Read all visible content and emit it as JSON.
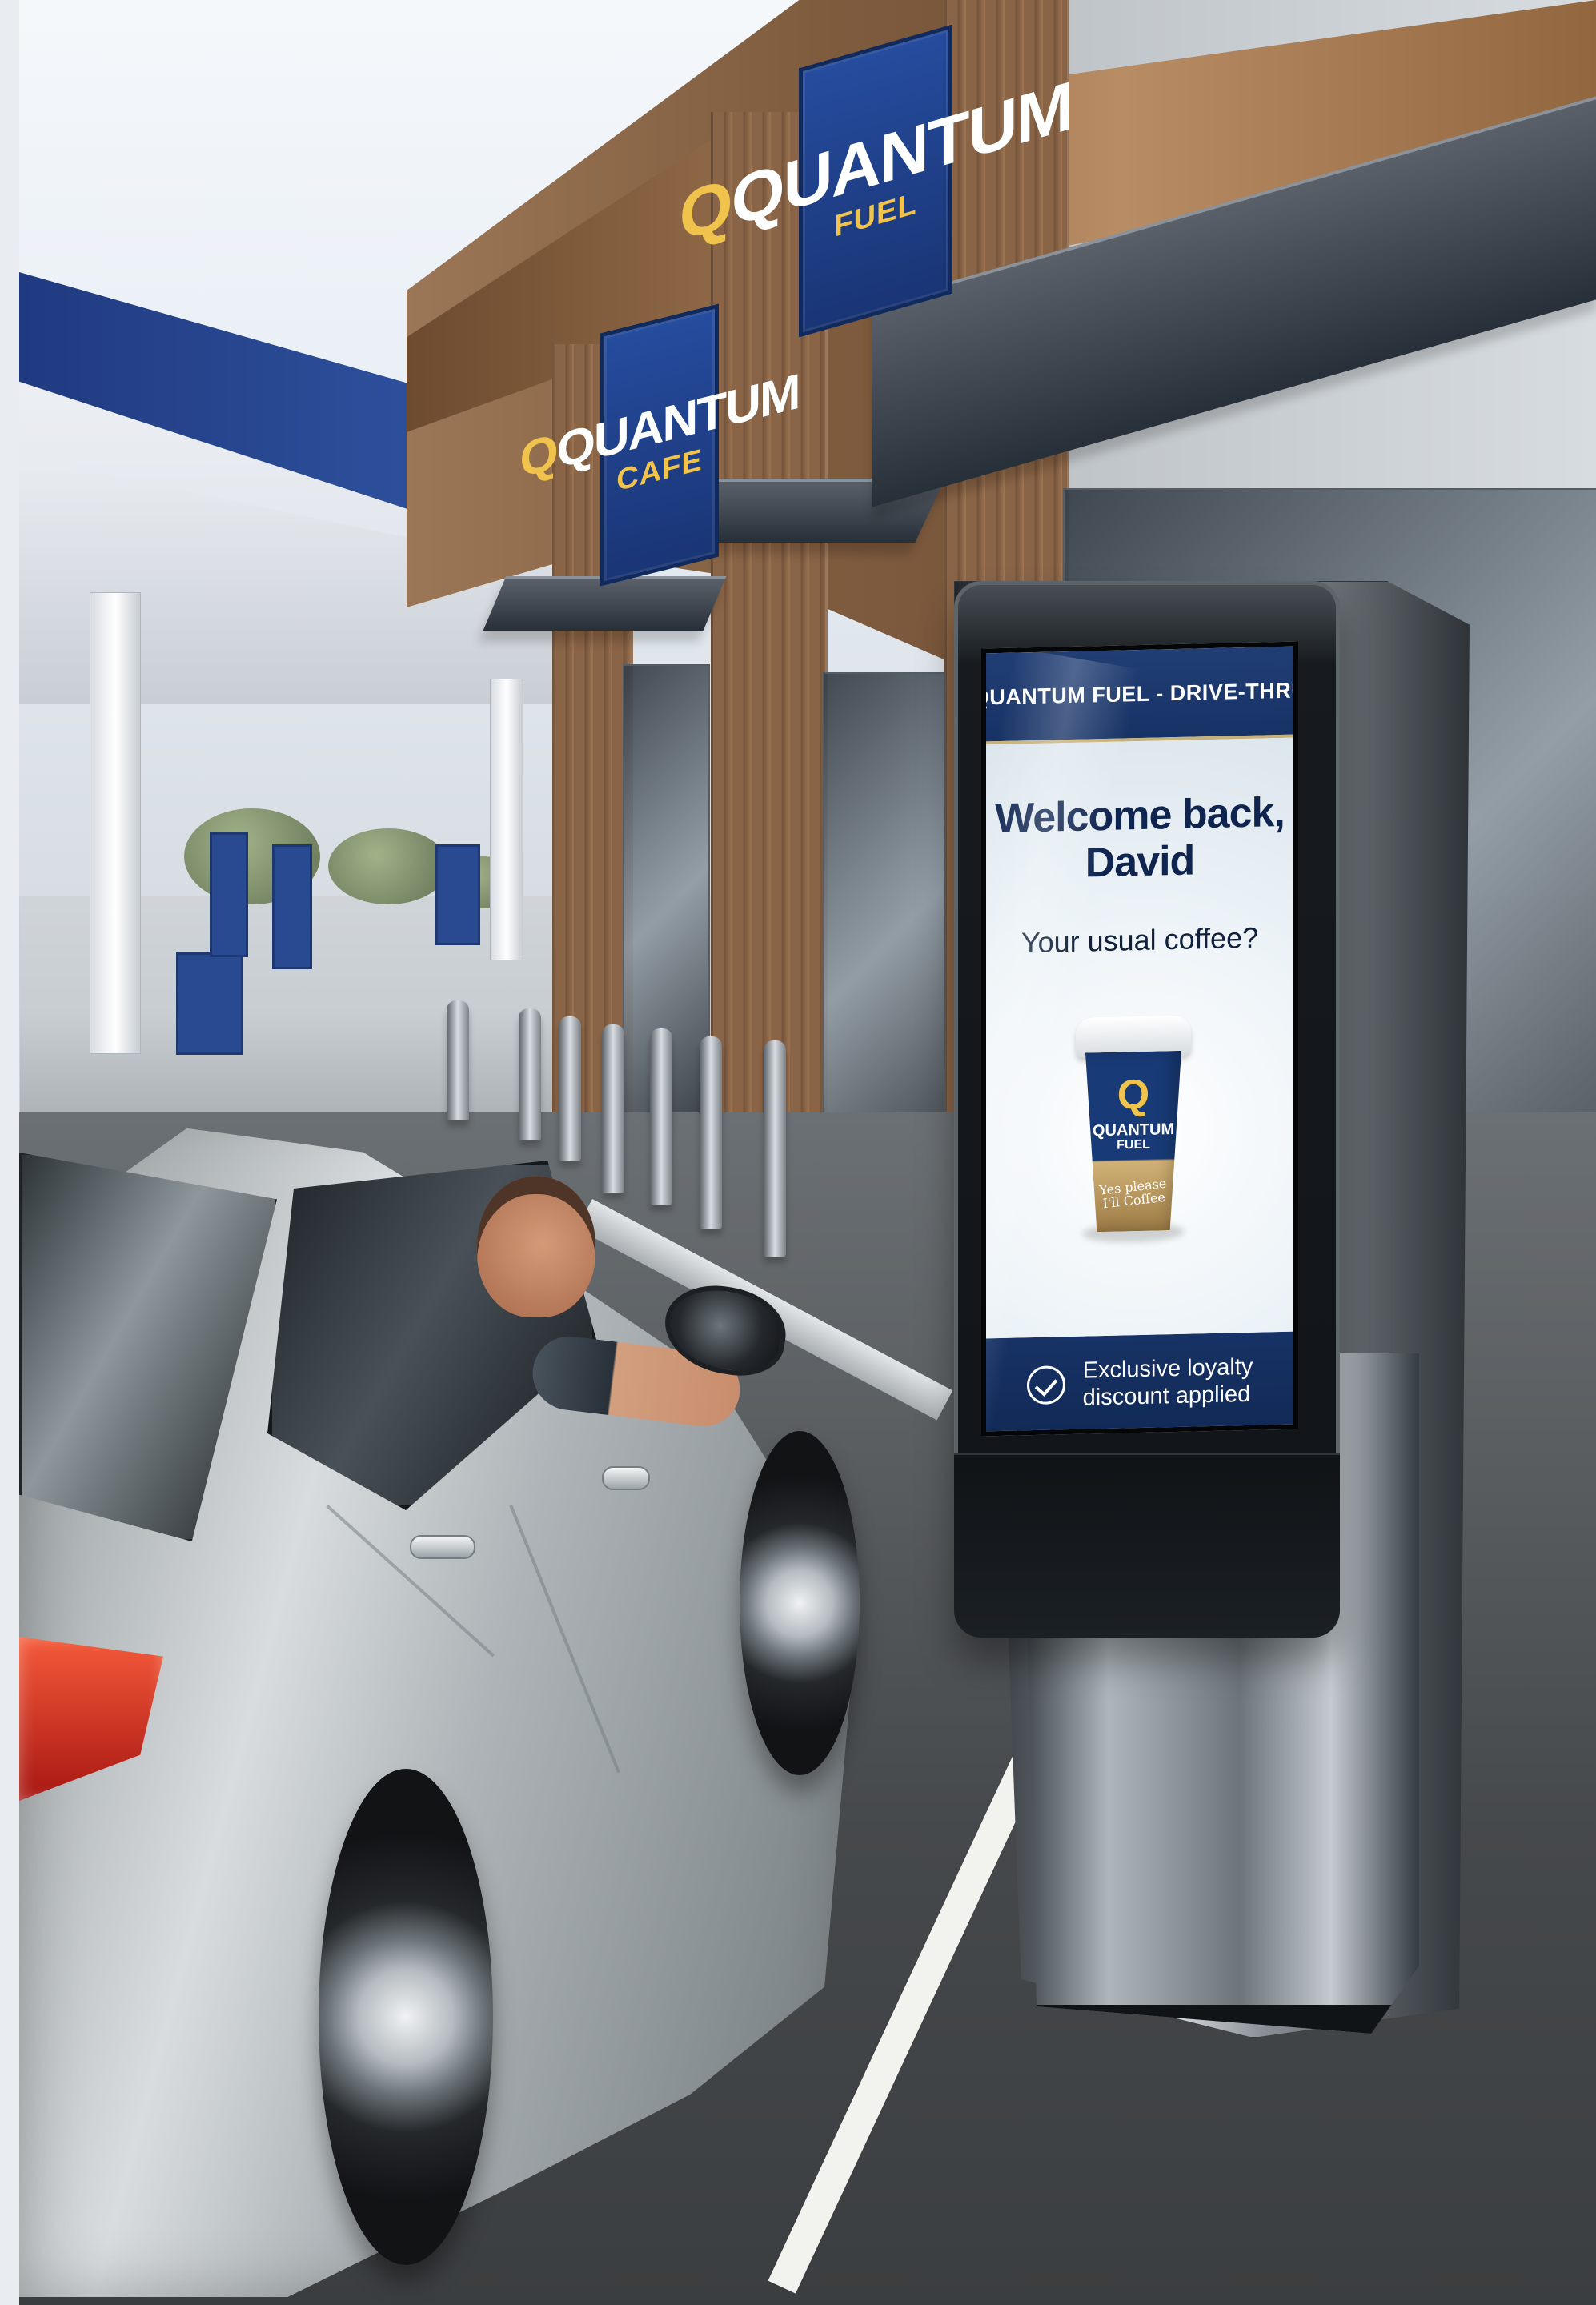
{
  "scene": {
    "type": "drive-thru kiosk photograph",
    "colors": {
      "brand_blue": "#183b77",
      "brand_gold": "#f0c34c",
      "screen_white": "#f8fbfd",
      "car_silver": "#b8bec1"
    }
  },
  "building_signs": {
    "top": {
      "main": "QUANTUM",
      "sub": "FUEL"
    },
    "middle": {
      "main": "QUANTUM",
      "sub": "CAFE"
    }
  },
  "kiosk": {
    "header": "QUANTUM FUEL - DRIVE-THRU",
    "welcome_line_1": "Welcome back,",
    "welcome_line_2": "David",
    "question": "Your usual coffee?",
    "cup": {
      "logo": "Q",
      "brand": "QUANTUM",
      "subbrand": "FUEL",
      "note_line_1": "Yes please",
      "note_line_2": "I'll Coffee"
    },
    "footer_icon": "check-circle-icon",
    "footer_line_1": "Exclusive loyalty",
    "footer_line_2": "discount applied"
  }
}
